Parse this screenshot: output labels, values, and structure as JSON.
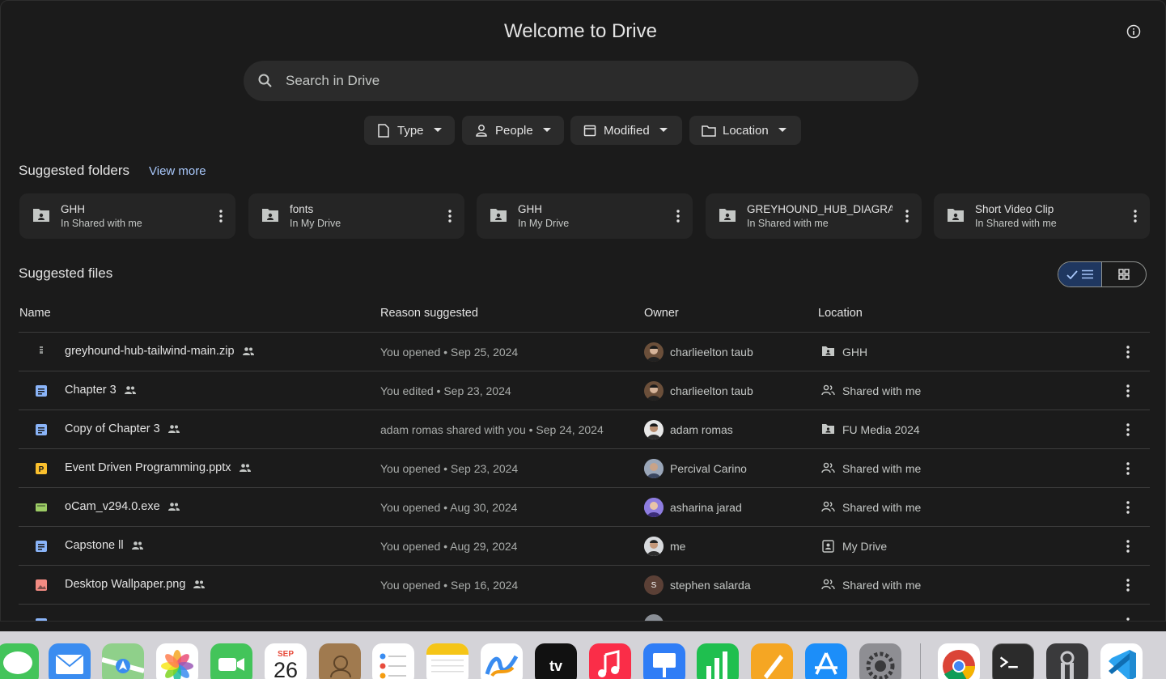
{
  "header": {
    "title": "Welcome to Drive"
  },
  "search": {
    "placeholder": "Search in Drive"
  },
  "filters": [
    {
      "label": "Type",
      "icon": "file-icon"
    },
    {
      "label": "People",
      "icon": "person-icon"
    },
    {
      "label": "Modified",
      "icon": "calendar-icon"
    },
    {
      "label": "Location",
      "icon": "folder-icon"
    }
  ],
  "suggested_folders": {
    "title": "Suggested folders",
    "view_more": "View more",
    "items": [
      {
        "name": "GHH",
        "location": "In Shared with me"
      },
      {
        "name": "fonts",
        "location": "In My Drive"
      },
      {
        "name": "GHH",
        "location": "In My Drive"
      },
      {
        "name": "GREYHOUND_HUB_DIAGRA...",
        "location": "In Shared with me"
      },
      {
        "name": "Short Video Clip",
        "location": "In Shared with me"
      }
    ]
  },
  "suggested_files": {
    "title": "Suggested files",
    "columns": {
      "name": "Name",
      "reason": "Reason suggested",
      "owner": "Owner",
      "location": "Location"
    },
    "rows": [
      {
        "name": "greyhound-hub-tailwind-main.zip",
        "type": "zip",
        "reason": "You opened • Sep 25, 2024",
        "owner": "charlieelton taub",
        "location": "GHH",
        "location_icon": "shared-folder-icon",
        "avatar_color": "#6b4f3a",
        "avatar_letter": ""
      },
      {
        "name": "Chapter 3",
        "type": "doc",
        "reason": "You edited • Sep 23, 2024",
        "owner": "charlieelton taub",
        "location": "Shared with me",
        "location_icon": "people-icon",
        "avatar_color": "#6b4f3a",
        "avatar_letter": ""
      },
      {
        "name": "Copy of Chapter 3",
        "type": "doc",
        "reason": "adam romas shared with you • Sep 24, 2024",
        "owner": "adam romas",
        "location": "FU Media 2024",
        "location_icon": "shared-folder-icon",
        "avatar_color": "#4a3d35",
        "avatar_letter": ""
      },
      {
        "name": "Event Driven Programming.pptx",
        "type": "pptx",
        "reason": "You opened • Sep 23, 2024",
        "owner": "Percival Carino",
        "location": "Shared with me",
        "location_icon": "people-icon",
        "avatar_color": "#5d6a80",
        "avatar_letter": ""
      },
      {
        "name": "oCam_v294.0.exe",
        "type": "exe",
        "reason": "You opened • Aug 30, 2024",
        "owner": "asharina jarad",
        "location": "Shared with me",
        "location_icon": "people-icon",
        "avatar_color": "#7b68c8",
        "avatar_letter": ""
      },
      {
        "name": "Capstone ll",
        "type": "doc",
        "reason": "You opened • Aug 29, 2024",
        "owner": "me",
        "location": "My Drive",
        "location_icon": "drive-icon",
        "avatar_color": "#8a8f96",
        "avatar_letter": ""
      },
      {
        "name": "Desktop Wallpaper.png",
        "type": "image",
        "reason": "You opened • Sep 16, 2024",
        "owner": "stephen salarda",
        "location": "Shared with me",
        "location_icon": "people-icon",
        "avatar_color": "#5b4036",
        "avatar_letter": "S"
      }
    ]
  },
  "dock": {
    "calendar_month": "SEP",
    "calendar_day": "26",
    "apps": [
      "Messages",
      "Mail",
      "Maps",
      "Photos",
      "FaceTime",
      "Calendar",
      "Contacts",
      "Reminders",
      "Notes",
      "Freeform",
      "TV",
      "Music",
      "Keynote",
      "Numbers",
      "Pages",
      "App Store",
      "System Settings",
      "Chrome",
      "Terminal",
      "Keychain Access",
      "Visual Studio Code"
    ]
  },
  "colors": {
    "background": "#1b1b1b",
    "accent": "#a8c7fa",
    "toggle_active": "#1f3760"
  }
}
